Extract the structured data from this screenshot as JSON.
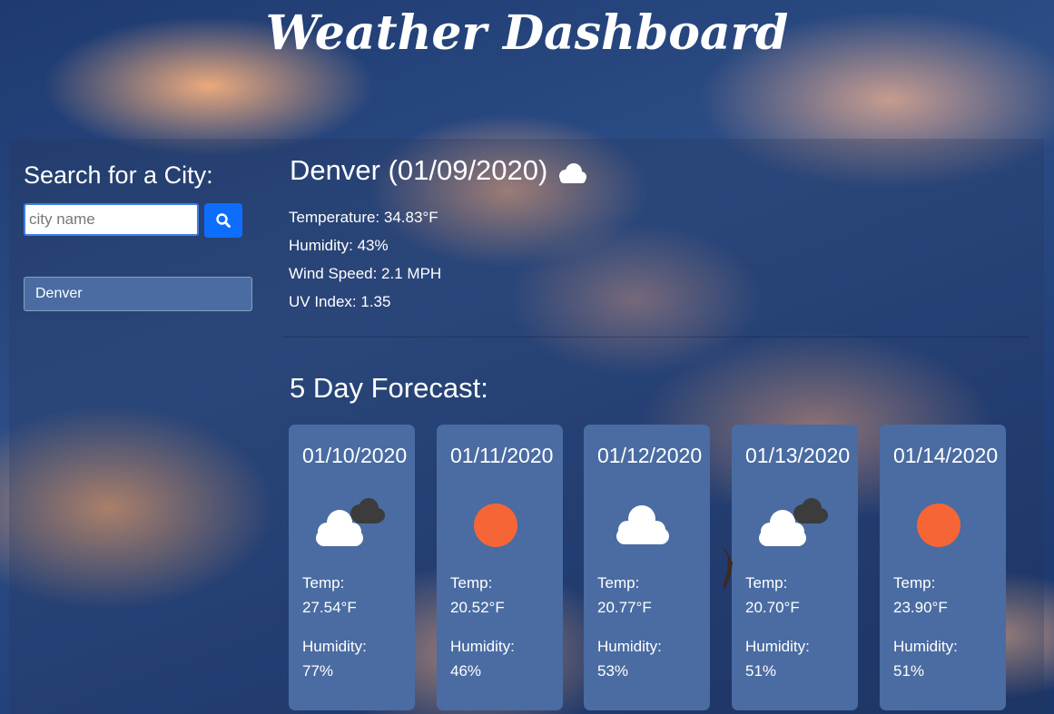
{
  "header": {
    "title": "Weather Dashboard"
  },
  "search": {
    "heading": "Search for a City:",
    "placeholder": "city name",
    "history": [
      "Denver"
    ]
  },
  "current": {
    "heading": "Denver (01/09/2020)",
    "icon": "cloud-icon",
    "temperature": "Temperature: 34.83°F",
    "humidity": "Humidity: 43%",
    "wind": "Wind Speed: 2.1 MPH",
    "uv": "UV Index: 1.35"
  },
  "forecast": {
    "heading": "5 Day Forecast:",
    "temp_label": "Temp:",
    "humidity_label": "Humidity:",
    "days": [
      {
        "date": "01/10/2020",
        "icon": "cloudy-icon",
        "temp": "27.54°F",
        "humidity": "77%"
      },
      {
        "date": "01/11/2020",
        "icon": "sun-icon",
        "temp": "20.52°F",
        "humidity": "46%"
      },
      {
        "date": "01/12/2020",
        "icon": "cloud-icon",
        "temp": "20.77°F",
        "humidity": "53%"
      },
      {
        "date": "01/13/2020",
        "icon": "cloudy-icon",
        "temp": "20.70°F",
        "humidity": "51%"
      },
      {
        "date": "01/14/2020",
        "icon": "sun-icon",
        "temp": "23.90°F",
        "humidity": "51%"
      }
    ]
  },
  "colors": {
    "card": "#4a6ca2",
    "accent": "#0d6efd",
    "sun": "#f66535"
  }
}
